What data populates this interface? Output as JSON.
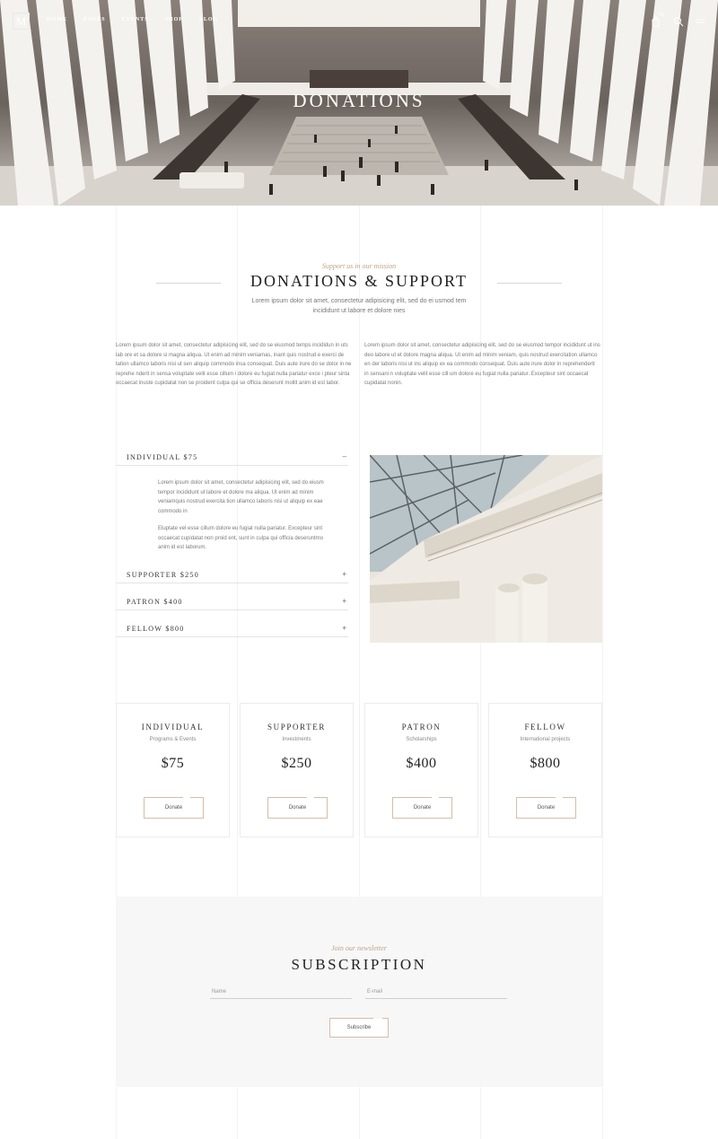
{
  "nav": {
    "logo": "M",
    "items": [
      "HOME",
      "PAGES",
      "EVENTS",
      "SHOP",
      "BLOG"
    ],
    "cart_count": "00",
    "icons": [
      "cart-icon",
      "search-icon",
      "menu-icon"
    ]
  },
  "hero": {
    "title": "DONATIONS"
  },
  "intro": {
    "tagline": "Support us in our mission",
    "title": "DONATIONS & SUPPORT",
    "subtitle": "Lorem ipsum dolor sit amet, consectetur adipisicing elit, sed do ei usmod tem incididunt ut labore et dolore nies",
    "col_left": "Lorem ipsum dolor sit amet, consectetur adipisicing elit, sed do se eiusmod temps incididun in uts lab ore et sa dolore si magna aliqua. Ut enim ad minim veniamas, inant quis nostrud e exerci de tation ullamco laboris nisi ut sen aliquip commodo insa consequat. Duis aute irure do se dolor in ne reprehe nderit in sensa voluptate velit esse cillum i dolore eu fugiat nulla pariatur exce i pteur sinta occaecat inuste cupidatat non se proident culpa qui se officia deserunt mollit anim id est labor.",
    "col_right": "Lorem ipsum dolor sit amet, consectetur adipisicing elit, sed do se eiusmod tempor incididunt ut ins deo labore ut et dolore magna aliqua. Ut enim ad minim veniam, quis nostrud exercitation ullamco en der laboris nisi ut ins aliquip ex ea commodo consequat. Duis aute irure dolor in reprehenderit in sensani n voluptate velit esse cill um dolore eu fugiat nulla pariatur. Excepteur sint occaecat cupidatat nonin."
  },
  "accordion": [
    {
      "label": "INDIVIDUAL $75",
      "symbol": "–"
    },
    {
      "label": "SUPPORTER $250",
      "symbol": "+"
    },
    {
      "label": "PATRON $400",
      "symbol": "+"
    },
    {
      "label": "FELLOW $800",
      "symbol": "+"
    }
  ],
  "accordion_body": {
    "p1": "Lorem ipsum dolor sit amet, consectetur adipisicing elit, sed do eiusm tempor incididunt ut labore et dolore ma aliqua. Ut enim ad minim veniamquis nostrud exercita tion ullamco laboris nisi ut aliquip ex eae commodo in",
    "p2": "Eluptate vel esse cillum dolore eu fugiat nulla pariatur. Excepteur sint occaecat cupidatat non proid ent, sunt in culpa qui officia deseruntmo anim id est laborum."
  },
  "plans": [
    {
      "name": "INDIVIDUAL",
      "sub": "Programs & Events",
      "price": "$75",
      "button": "Donate"
    },
    {
      "name": "SUPPORTER",
      "sub": "Investments",
      "price": "$250",
      "button": "Donate"
    },
    {
      "name": "PATRON",
      "sub": "Scholarships",
      "price": "$400",
      "button": "Donate"
    },
    {
      "name": "FELLOW",
      "sub": "International projects",
      "price": "$800",
      "button": "Donate"
    }
  ],
  "subscription": {
    "tagline": "Join our newsletter",
    "title": "SUBSCRIPTION",
    "name_placeholder": "Name",
    "email_placeholder": "E-mail",
    "button": "Subscribe"
  },
  "colors": {
    "accent": "#c2a38a",
    "text_dark": "#222222",
    "panel": "#f7f7f7"
  }
}
